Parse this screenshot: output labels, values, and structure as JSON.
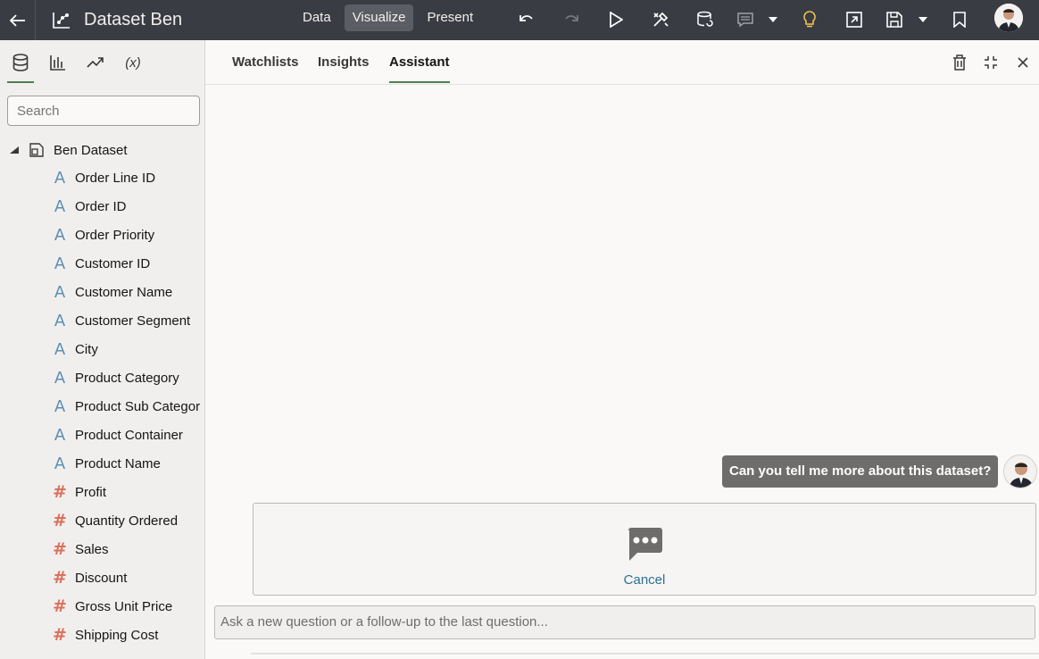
{
  "topbar": {
    "title": "Dataset Ben",
    "nav": [
      "Data",
      "Visualize",
      "Present"
    ],
    "active_nav": "Visualize",
    "colors": {
      "bg": "#3a3c44",
      "accent_bulb": "#f0c44c"
    }
  },
  "leftpanel": {
    "search_placeholder": "Search",
    "function_tab_label": "(x)",
    "dataset_name": "Ben Dataset",
    "fields": [
      {
        "type": "attribute",
        "label": "Order Line ID"
      },
      {
        "type": "attribute",
        "label": "Order ID"
      },
      {
        "type": "attribute",
        "label": "Order Priority"
      },
      {
        "type": "attribute",
        "label": "Customer ID"
      },
      {
        "type": "attribute",
        "label": "Customer Name"
      },
      {
        "type": "attribute",
        "label": "Customer Segment"
      },
      {
        "type": "attribute",
        "label": "City"
      },
      {
        "type": "attribute",
        "label": "Product Category"
      },
      {
        "type": "attribute",
        "label": "Product Sub Categor"
      },
      {
        "type": "attribute",
        "label": "Product Container"
      },
      {
        "type": "attribute",
        "label": "Product Name"
      },
      {
        "type": "measure",
        "label": "Profit"
      },
      {
        "type": "measure",
        "label": "Quantity Ordered"
      },
      {
        "type": "measure",
        "label": "Sales"
      },
      {
        "type": "measure",
        "label": "Discount"
      },
      {
        "type": "measure",
        "label": "Gross Unit Price"
      },
      {
        "type": "measure",
        "label": "Shipping Cost"
      }
    ],
    "attribute_glyph": "A",
    "measure_glyph": "#"
  },
  "main": {
    "tabs": [
      "Watchlists",
      "Insights",
      "Assistant"
    ],
    "active_tab": "Assistant",
    "user_message": "Can you tell me more about this dataset?",
    "cancel_label": "Cancel",
    "ask_placeholder": "Ask a new question or a follow-up to the last question..."
  }
}
